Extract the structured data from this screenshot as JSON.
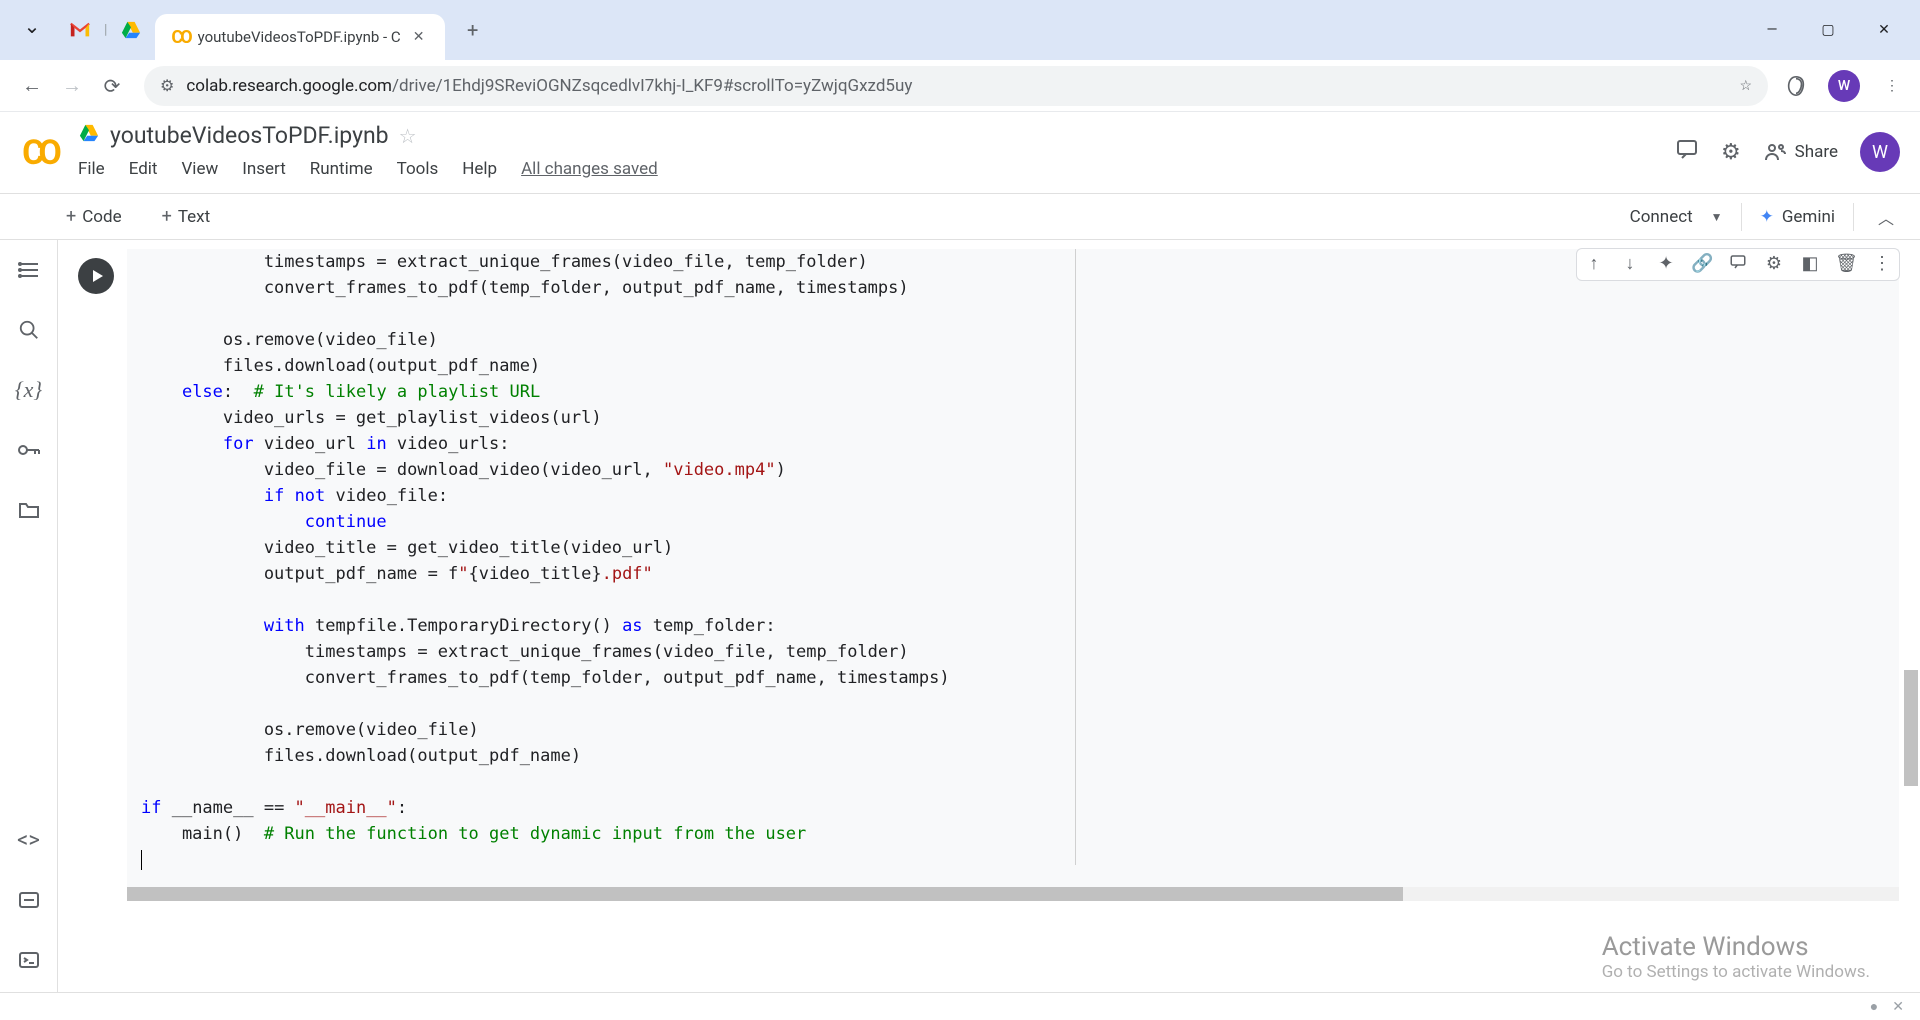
{
  "browser": {
    "active_tab_title": "youtubeVideosToPDF.ipynb - C",
    "url_host": "colab.research.google.com",
    "url_path": "/drive/1Ehdj9SReviOGNZsqcedlvI7khj-I_KF9#scrollTo=yZwjqGxzd5uy",
    "avatar_letter": "W"
  },
  "colab": {
    "notebook_name": "youtubeVideosToPDF.ipynb",
    "menus": [
      "File",
      "Edit",
      "View",
      "Insert",
      "Runtime",
      "Tools",
      "Help"
    ],
    "save_status": "All changes saved",
    "share_label": "Share",
    "avatar_letter": "W"
  },
  "toolbar": {
    "code_label": "Code",
    "text_label": "Text",
    "connect_label": "Connect",
    "gemini_label": "Gemini"
  },
  "watermark": {
    "title": "Activate Windows",
    "subtitle": "Go to Settings to activate Windows."
  },
  "code_lines": [
    [
      [
        "            timestamps = extract_unique_frames(video_file, temp_folder)",
        "plain"
      ]
    ],
    [
      [
        "            convert_frames_to_pdf(temp_folder, output_pdf_name, timestamps)",
        "plain"
      ]
    ],
    [
      [
        "",
        "plain"
      ]
    ],
    [
      [
        "        os.remove(video_file)",
        "plain"
      ]
    ],
    [
      [
        "        files.download(output_pdf_name)",
        "plain"
      ]
    ],
    [
      [
        "    ",
        "plain"
      ],
      [
        "else",
        "kw"
      ],
      [
        ":",
        "plain"
      ],
      [
        "  ",
        "plain"
      ],
      [
        "# It's likely a playlist URL",
        "com"
      ]
    ],
    [
      [
        "        video_urls = get_playlist_videos(url)",
        "plain"
      ]
    ],
    [
      [
        "        ",
        "plain"
      ],
      [
        "for",
        "kw"
      ],
      [
        " video_url ",
        "plain"
      ],
      [
        "in",
        "kw"
      ],
      [
        " video_urls:",
        "plain"
      ]
    ],
    [
      [
        "            video_file = download_video(video_url, ",
        ""
      ],
      [
        "\"video.mp4\"",
        "str"
      ],
      [
        ")",
        "plain"
      ]
    ],
    [
      [
        "            ",
        "plain"
      ],
      [
        "if",
        "kw"
      ],
      [
        " ",
        "plain"
      ],
      [
        "not",
        "kw"
      ],
      [
        " video_file:",
        "plain"
      ]
    ],
    [
      [
        "                ",
        "plain"
      ],
      [
        "continue",
        "kw"
      ]
    ],
    [
      [
        "            video_title = get_video_title(video_url)",
        "plain"
      ]
    ],
    [
      [
        "            output_pdf_name = f",
        ""
      ],
      [
        "\"",
        "str"
      ],
      [
        "{video_title}",
        ""
      ],
      [
        ".pdf\"",
        "str"
      ]
    ],
    [
      [
        "",
        "plain"
      ]
    ],
    [
      [
        "            ",
        "plain"
      ],
      [
        "with",
        "kw"
      ],
      [
        " tempfile.TemporaryDirectory() ",
        "plain"
      ],
      [
        "as",
        "kw"
      ],
      [
        " temp_folder:",
        "plain"
      ]
    ],
    [
      [
        "                timestamps = extract_unique_frames(video_file, temp_folder)",
        "plain"
      ]
    ],
    [
      [
        "                convert_frames_to_pdf(temp_folder, output_pdf_name, timestamps)",
        "plain"
      ]
    ],
    [
      [
        "",
        "plain"
      ]
    ],
    [
      [
        "            os.remove(video_file)",
        "plain"
      ]
    ],
    [
      [
        "            files.download(output_pdf_name)",
        "plain"
      ]
    ],
    [
      [
        "",
        "plain"
      ]
    ],
    [
      [
        "",
        "plain"
      ],
      [
        "if",
        "kw"
      ],
      [
        " __name__ == ",
        ""
      ],
      [
        "\"__main__\"",
        "str"
      ],
      [
        ":",
        "plain"
      ]
    ],
    [
      [
        "    main()  ",
        ""
      ],
      [
        "# Run the function to get dynamic input from the user",
        "com"
      ]
    ]
  ]
}
